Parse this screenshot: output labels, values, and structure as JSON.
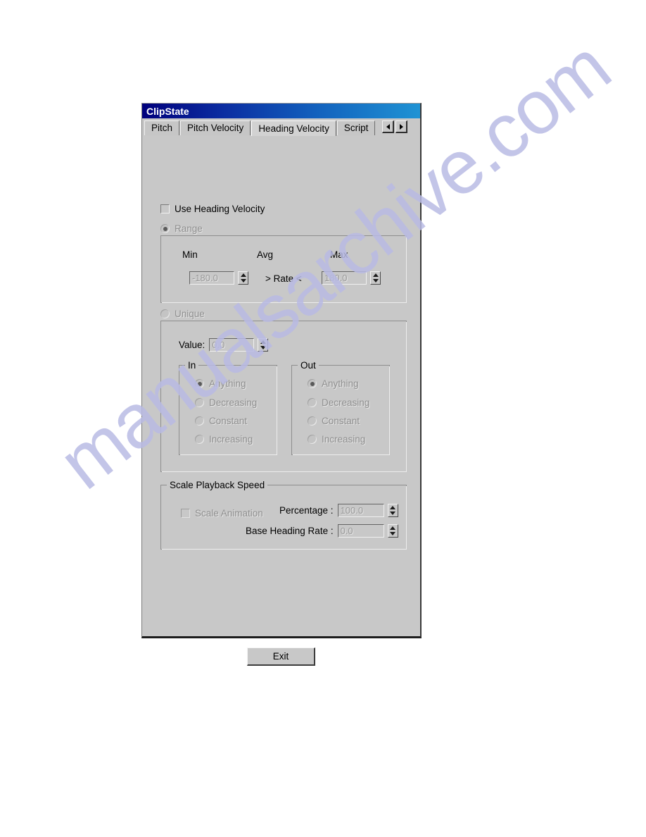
{
  "window": {
    "title": "ClipState"
  },
  "tabs": [
    {
      "label": "Pitch",
      "selected": false
    },
    {
      "label": "Pitch Velocity",
      "selected": false
    },
    {
      "label": "Heading Velocity",
      "selected": true
    },
    {
      "label": "Script",
      "selected": false
    }
  ],
  "tab_scroll": {
    "left_icon": "triangle-left-icon",
    "right_icon": "triangle-right-icon"
  },
  "use_heading_velocity": {
    "label": "Use Heading Velocity",
    "checked": false,
    "enabled": true
  },
  "mode": {
    "range": {
      "label": "Range",
      "selected": true,
      "enabled": false
    },
    "unique": {
      "label": "Unique",
      "selected": false,
      "enabled": false
    }
  },
  "range_group": {
    "headers": {
      "min": "Min",
      "avg": "Avg",
      "max": "Max"
    },
    "min_value": "-180.0",
    "max_value": "180.0",
    "rate_label": "> Rate <"
  },
  "unique_group": {
    "value_label": "Value:",
    "value": "0.0",
    "in": {
      "title": "In",
      "options": [
        {
          "label": "Anything",
          "selected": true
        },
        {
          "label": "Decreasing",
          "selected": false
        },
        {
          "label": "Constant",
          "selected": false
        },
        {
          "label": "Increasing",
          "selected": false
        }
      ]
    },
    "out": {
      "title": "Out",
      "options": [
        {
          "label": "Anything",
          "selected": true
        },
        {
          "label": "Decreasing",
          "selected": false
        },
        {
          "label": "Constant",
          "selected": false
        },
        {
          "label": "Increasing",
          "selected": false
        }
      ]
    }
  },
  "scale_playback": {
    "title": "Scale Playback Speed",
    "scale_animation": {
      "label": "Scale Animation",
      "checked": false,
      "enabled": false
    },
    "percentage_label": "Percentage :",
    "percentage_value": "100.0",
    "base_rate_label": "Base Heading Rate :",
    "base_rate_value": "0.0"
  },
  "footer": {
    "exit_label": "Exit"
  },
  "watermark": {
    "text": "manualsarchive.com"
  },
  "colors": {
    "dialog_face": "#c8c8c8",
    "title_start": "#00007c",
    "title_end": "#1f93d4",
    "disabled_text": "#8f8f8f",
    "watermark": "#b9bbe4"
  }
}
